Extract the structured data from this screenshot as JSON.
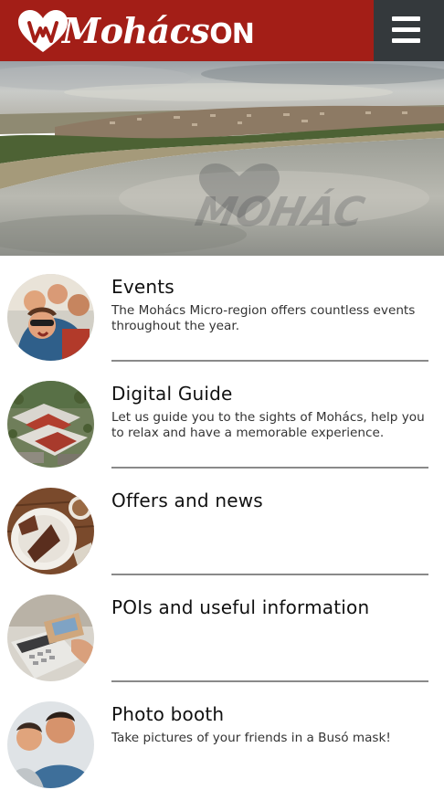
{
  "header": {
    "logo_text": "Mohács",
    "logo_suffix": "ON",
    "menu_icon": "hamburger-menu-icon",
    "brand_color": "#a31e17",
    "menu_bg_color": "#34393c"
  },
  "hero": {
    "watermark_text": "MOHÁC"
  },
  "items": [
    {
      "title": "Events",
      "description": "The Mohács Micro-region offers countless events throughout the year."
    },
    {
      "title": "Digital Guide",
      "description": "Let us guide you to the sights of Mohács, help you to relax and have a memorable experience."
    },
    {
      "title": "Offers and news",
      "description": ""
    },
    {
      "title": "POIs and useful information",
      "description": ""
    },
    {
      "title": "Photo booth",
      "description": "Take pictures of your friends in a Busó mask!"
    }
  ]
}
